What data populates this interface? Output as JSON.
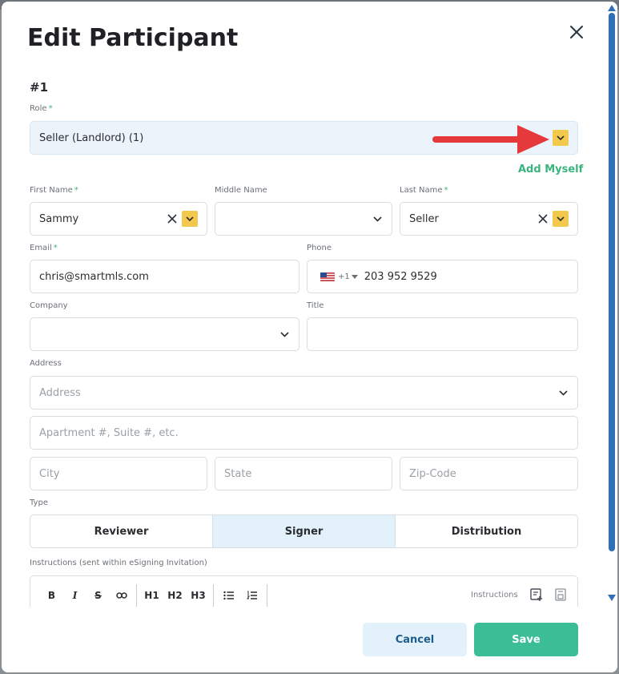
{
  "dialog": {
    "title": "Edit Participant",
    "section_number": "#1"
  },
  "role": {
    "label": "Role",
    "required_mark": "*",
    "value": "Seller (Landlord)  (1)"
  },
  "add_myself": "Add Myself",
  "name": {
    "first_label": "First Name",
    "first_value": "Sammy",
    "middle_label": "Middle Name",
    "middle_value": "",
    "last_label": "Last Name",
    "last_value": "Seller",
    "required_mark": "*"
  },
  "contact": {
    "email_label": "Email",
    "email_value": "chris@smartmls.com",
    "phone_label": "Phone",
    "phone_country_code": "+1",
    "phone_value": "203 952 9529",
    "required_mark": "*"
  },
  "company": {
    "company_label": "Company",
    "title_label": "Title"
  },
  "address": {
    "label": "Address",
    "address_placeholder": "Address",
    "apartment_placeholder": "Apartment #, Suite #, etc.",
    "city_placeholder": "City",
    "state_placeholder": "State",
    "zip_placeholder": "Zip-Code"
  },
  "type": {
    "label": "Type",
    "options": [
      "Reviewer",
      "Signer",
      "Distribution"
    ],
    "selected": "Signer"
  },
  "instructions": {
    "label": "Instructions (sent within eSigning Invitation)",
    "toolbar": [
      "B",
      "I",
      "S",
      "link",
      "H1",
      "H2",
      "H3",
      "bullet-list",
      "numbered-list"
    ],
    "right_label": "Instructions"
  },
  "footer": {
    "cancel_label": "Cancel",
    "save_label": "Save"
  },
  "colors": {
    "accent_green": "#3bb37d",
    "save_green": "#3bbd96",
    "dropdown_yellow": "#f2c94c",
    "arrow_red": "#e5393c",
    "selected_tab_bg": "#e3f1fb",
    "scrollbar_blue": "#2f6fb5"
  }
}
